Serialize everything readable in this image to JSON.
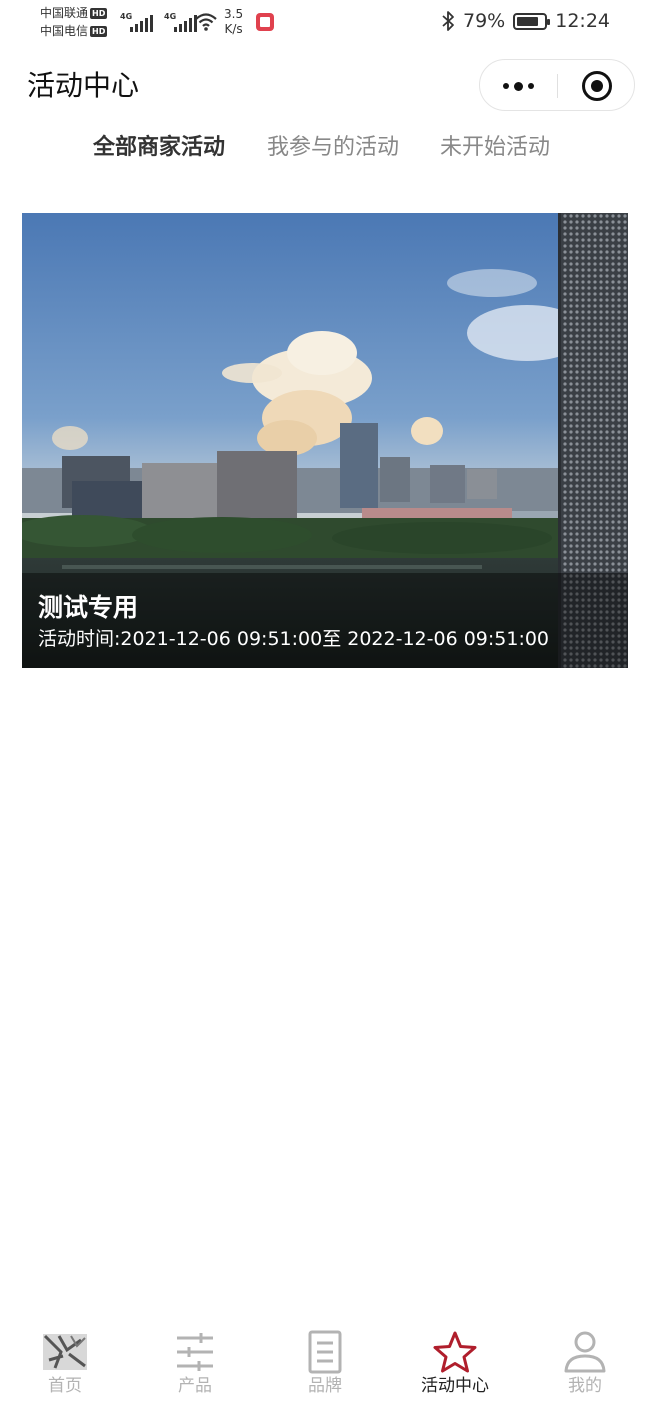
{
  "status_bar": {
    "carrier_1": "中国联通",
    "carrier_2": "中国电信",
    "hd_badge": "HD",
    "network_1": "4G",
    "network_2": "4G",
    "speed_value": "3.5",
    "speed_unit": "K/s",
    "battery_percent": "79%",
    "battery_level": 0.79,
    "time": "12:24"
  },
  "nav": {
    "title": "活动中心",
    "more_icon": "more-dots-icon",
    "close_icon": "target-circle-icon"
  },
  "tabs": [
    {
      "label": "全部商家活动",
      "active": true
    },
    {
      "label": "我参与的活动",
      "active": false
    },
    {
      "label": "未开始活动",
      "active": false
    }
  ],
  "activities": [
    {
      "title": "测试专用",
      "time": "活动时间:2021-12-06 09:51:00至 2022-12-06 09:51:00"
    }
  ],
  "tabbar": {
    "active_color": "#b01e2c",
    "inactive_color": "#b3b3b3",
    "items": [
      {
        "label": "首页",
        "icon": "home-logo-icon",
        "active": false
      },
      {
        "label": "产品",
        "icon": "sliders-icon",
        "active": false
      },
      {
        "label": "品牌",
        "icon": "document-icon",
        "active": false
      },
      {
        "label": "活动中心",
        "icon": "star-icon",
        "active": true
      },
      {
        "label": "我的",
        "icon": "user-icon",
        "active": false
      }
    ]
  }
}
